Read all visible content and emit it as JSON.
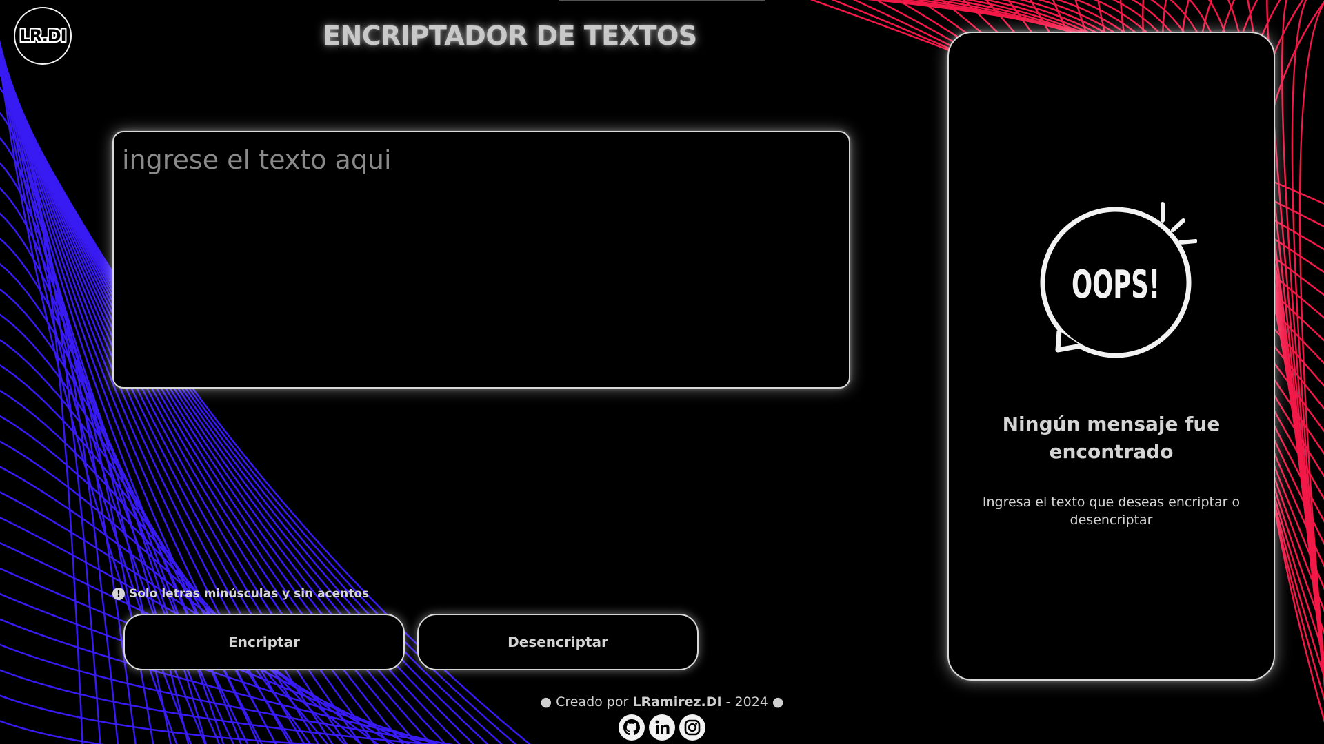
{
  "logo": {
    "text": "LR.DI"
  },
  "header": {
    "title": "ENCRIPTADOR DE TEXTOS"
  },
  "input": {
    "placeholder": "ingrese el texto aqui",
    "value": ""
  },
  "hint": {
    "icon": "info-icon",
    "text": "Solo letras minúsculas y sin acentos"
  },
  "buttons": {
    "encrypt_label": "Encriptar",
    "decrypt_label": "Desencriptar"
  },
  "result": {
    "illustration_text": "OOPS!",
    "heading": "Ningún mensaje fue encontrado",
    "subtext": "Ingresa el texto que deseas encriptar o desencriptar"
  },
  "footer": {
    "prefix": "● Creado por ",
    "author": "LRamirez.DI",
    "suffix": " - 2024 ●",
    "socials": [
      "github-icon",
      "linkedin-icon",
      "instagram-icon"
    ]
  },
  "colors": {
    "background": "#000000",
    "accent_blue": "#3b1cff",
    "accent_red": "#ff1a4b",
    "text": "#d4d4d4"
  }
}
